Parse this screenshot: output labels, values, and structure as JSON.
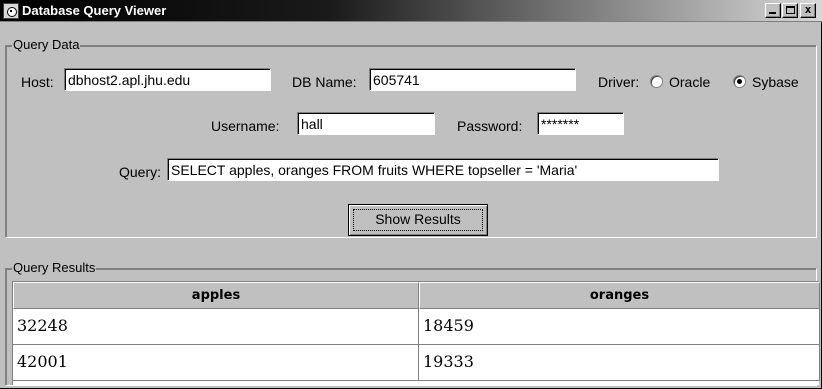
{
  "window": {
    "title": "Database Query Viewer",
    "buttons": {
      "minimize": "_",
      "maximize": "□",
      "close": "x"
    }
  },
  "query_data": {
    "group_title": "Query Data",
    "host_label": "Host:",
    "host_value": "dbhost2.apl.jhu.edu",
    "dbname_label": "DB Name:",
    "dbname_value": "605741",
    "driver_label": "Driver:",
    "driver_options": [
      {
        "label": "Oracle",
        "selected": false
      },
      {
        "label": "Sybase",
        "selected": true
      }
    ],
    "username_label": "Username:",
    "username_value": "hall",
    "password_label": "Password:",
    "password_value": "*******",
    "query_label": "Query:",
    "query_value": "SELECT apples, oranges FROM fruits WHERE topseller = 'Maria'",
    "show_results_label": "Show Results"
  },
  "query_results": {
    "group_title": "Query Results",
    "columns": [
      "apples",
      "oranges"
    ],
    "rows": [
      [
        "32248",
        "18459"
      ],
      [
        "42001",
        "19333"
      ]
    ]
  }
}
